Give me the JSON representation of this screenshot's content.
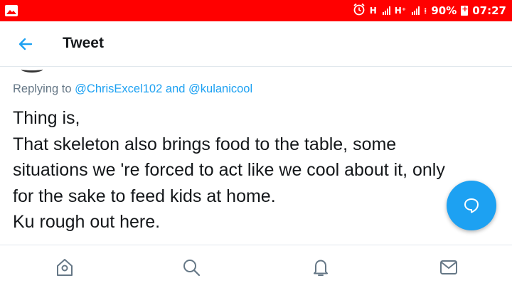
{
  "status_bar": {
    "network_1": "H",
    "network_2": "H⁺",
    "battery": "90%",
    "time": "07:27",
    "color": "#ff0000"
  },
  "header": {
    "title": "Tweet",
    "back_icon": "arrow-left-icon"
  },
  "tweet": {
    "replying_prefix": "Replying to",
    "mention_1": "@ChrisExcel102",
    "conjunction": "and",
    "mention_2": "@kulanicool",
    "lines": [
      "Thing is,",
      "That skeleton also brings food to the table, some",
      "situations we 're forced to act like we cool about it, only",
      "for the sake to feed kids at home.",
      "Ku rough out here."
    ]
  },
  "fab": {
    "icon": "speech-bubble-icon",
    "color": "#1da1f2"
  },
  "bottom_nav": {
    "items": [
      {
        "name": "home",
        "icon": "home-icon"
      },
      {
        "name": "search",
        "icon": "search-icon"
      },
      {
        "name": "notifications",
        "icon": "bell-icon"
      },
      {
        "name": "messages",
        "icon": "mail-icon"
      }
    ]
  },
  "colors": {
    "accent": "#1da1f2",
    "text": "#14171a",
    "secondary_text": "#657786"
  }
}
